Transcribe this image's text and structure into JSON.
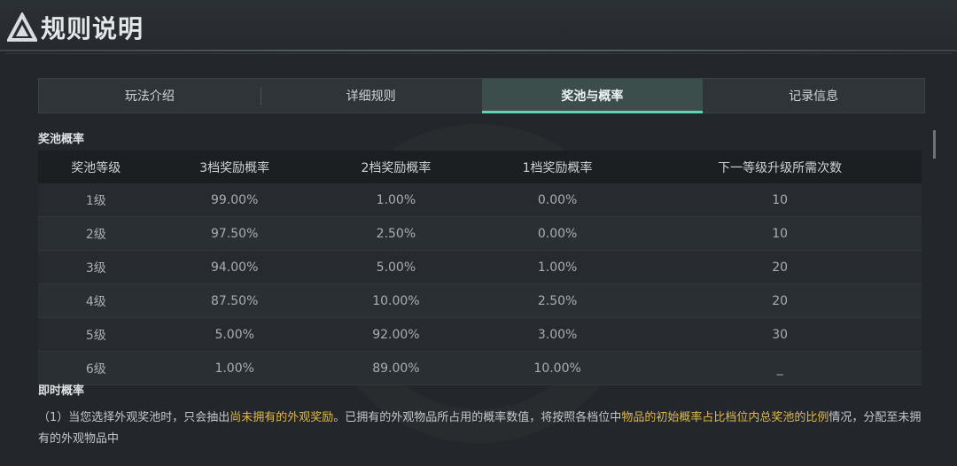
{
  "header": {
    "title": "规则说明",
    "logo_icon": "triangle-logo-icon"
  },
  "tabs": [
    {
      "label": "玩法介绍",
      "active": false
    },
    {
      "label": "详细规则",
      "active": false
    },
    {
      "label": "奖池与概率",
      "active": true
    },
    {
      "label": "记录信息",
      "active": false
    }
  ],
  "pool_section": {
    "title": "奖池概率",
    "columns": [
      "奖池等级",
      "3档奖励概率",
      "2档奖励概率",
      "1档奖励概率",
      "下一等级升级所需次数"
    ],
    "rows": [
      [
        "1级",
        "99.00%",
        "1.00%",
        "0.00%",
        "10"
      ],
      [
        "2级",
        "97.50%",
        "2.50%",
        "0.00%",
        "10"
      ],
      [
        "3级",
        "94.00%",
        "5.00%",
        "1.00%",
        "20"
      ],
      [
        "4级",
        "87.50%",
        "10.00%",
        "2.50%",
        "20"
      ],
      [
        "5级",
        "5.00%",
        "92.00%",
        "3.00%",
        "30"
      ],
      [
        "6级",
        "1.00%",
        "89.00%",
        "10.00%",
        "_"
      ]
    ]
  },
  "instant_section": {
    "title": "即时概率",
    "p1": "（1）当您选择外观奖池时，只会抽出",
    "p1_hl1": "尚未拥有的外观奖励",
    "p2": "。已拥有的外观物品所占用的概率数值，将按照各档位中",
    "p2_hl2": "物品的初始概率占比档位内总奖池的比例",
    "p3": "情况，分配至未拥有的外观物品中"
  },
  "colors": {
    "accent": "#5fd6b0",
    "highlight": "#e0b94a",
    "background": "#23272b"
  }
}
